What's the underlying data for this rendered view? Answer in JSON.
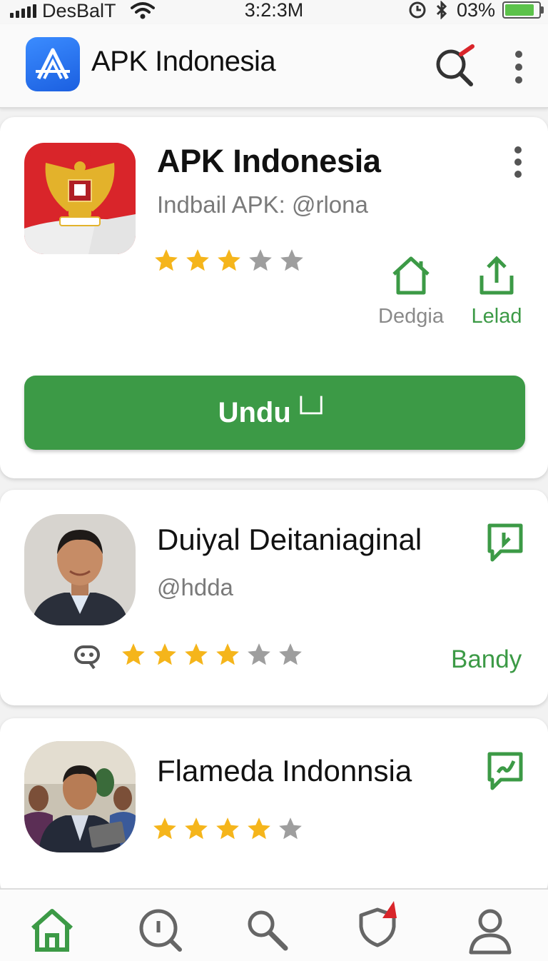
{
  "status_bar": {
    "carrier": "DesBalT",
    "time": "3:2:3M",
    "battery": "03%"
  },
  "app_bar": {
    "title": "APK Indonesia"
  },
  "featured": {
    "title": "APK Indonesia",
    "subtitle": "Indbail APK: @rlona",
    "rating": 3,
    "rating_max": 5,
    "actions": [
      {
        "label": "Dedgia",
        "icon": "home-outline-icon",
        "color": "#8a8a8a"
      },
      {
        "label": "Lelad",
        "icon": "share-icon",
        "color": "#3c9a46"
      }
    ],
    "download_label": "Undu└┘"
  },
  "items": [
    {
      "title": "Duiyal Deitaniaginal",
      "handle": "@hdda",
      "rating": 4,
      "rating_max": 6,
      "tag": "Bandy",
      "icon": "chat-play-icon"
    },
    {
      "title": "Flameda Indonnsia",
      "rating": 4,
      "rating_max": 5,
      "icon": "chat-edit-icon"
    }
  ],
  "colors": {
    "accent": "#3c9a46",
    "star": "#f5b51b",
    "star_empty": "#9e9e9e",
    "flag_red": "#d9252a"
  }
}
